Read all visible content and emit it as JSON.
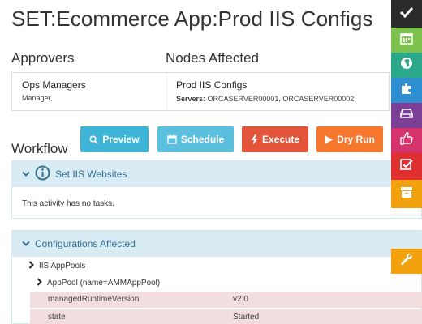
{
  "page": {
    "title": "SET:Ecommerce App:Prod IIS Configs"
  },
  "approvers": {
    "heading": "Approvers",
    "name": "Ops Managers",
    "role": "Manager,"
  },
  "nodes": {
    "heading": "Nodes Affected",
    "name": "Prod IIS Configs",
    "servers_label": "Servers:",
    "servers_value": "ORCASERVER00001, ORCASERVER00002"
  },
  "workflow": {
    "heading": "Workflow",
    "buttons": {
      "preview": "Preview",
      "schedule": "Schedule",
      "execute": "Execute",
      "dry_run": "Dry Run"
    }
  },
  "activity": {
    "title": "Set IIS Websites",
    "empty_text": "This activity has no tasks."
  },
  "configurations": {
    "title": "Configurations Affected",
    "tree": {
      "level1": "IIS AppPools",
      "level2": "AppPool (name=AMMAppPool)"
    },
    "rows": [
      {
        "key": "managedRuntimeVersion",
        "value": "v2.0"
      },
      {
        "key": "state",
        "value": "Started"
      }
    ]
  },
  "colors": {
    "preview": "#3eb5d6",
    "schedule": "#5bc0de",
    "execute": "#e2553b",
    "dry_run": "#f6782f",
    "rail": [
      "#2b2b2b",
      "#7cc24c",
      "#2aa889",
      "#2e8ed0",
      "#7b3f98",
      "#d6336c",
      "#e02f2f",
      "#f2a10f",
      "#f2a10f"
    ]
  },
  "rail_icons": [
    "check-icon",
    "calendar-icon",
    "globe-icon",
    "puzzle-icon",
    "hdd-icon",
    "thumbs-up-icon",
    "checked-list-icon",
    "archive-icon",
    "wrench-icon"
  ]
}
